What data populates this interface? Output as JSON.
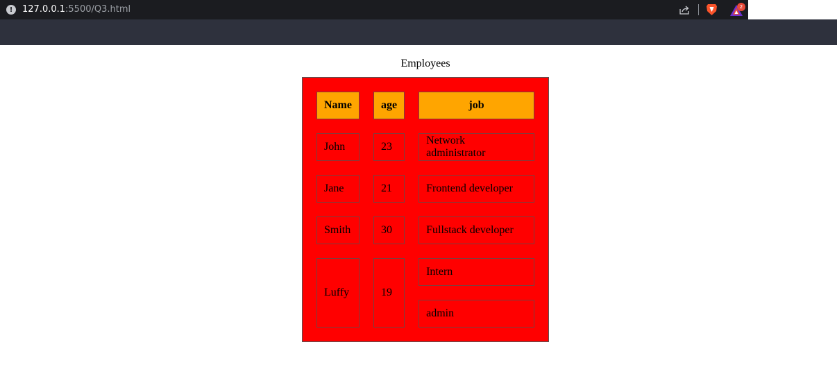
{
  "browser": {
    "url_host": "127.0.0.1",
    "url_path": ":5500/Q3.html",
    "rewards_badge": "2"
  },
  "page": {
    "caption": "Employees",
    "headers": {
      "name": "Name",
      "age": "age",
      "job": "job"
    },
    "rows": [
      {
        "name": "John",
        "age": "23",
        "job": "Network administrator"
      },
      {
        "name": "Jane",
        "age": "21",
        "job": "Frontend developer"
      },
      {
        "name": "Smith",
        "age": "30",
        "job": "Fullstack developer"
      },
      {
        "name": "Luffy",
        "age": "19",
        "jobs": [
          "Intern",
          "admin"
        ]
      }
    ]
  },
  "colors": {
    "table_background": "#ff0000",
    "header_background": "#ffa500"
  }
}
